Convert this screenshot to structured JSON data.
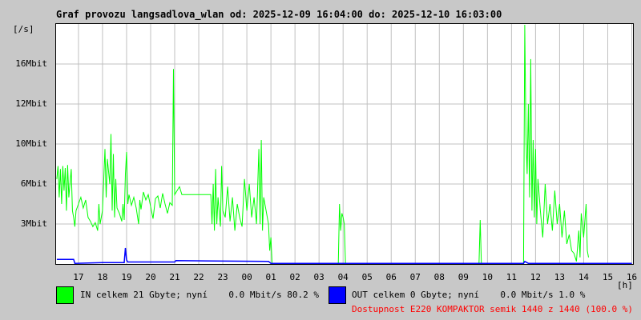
{
  "chart_data": {
    "type": "line",
    "title": "Graf provozu langsadlova_wlan od: 2025-12-09 16:04:00 do: 2025-12-10 16:03:00",
    "ylabel": "[/s]",
    "xlabel": "[h]",
    "y_ticks": [
      {
        "label": "3Mbit",
        "value": 3
      },
      {
        "label": "6Mbit",
        "value": 6
      },
      {
        "label": "10Mbit",
        "value": 10
      },
      {
        "label": "12Mbit",
        "value": 12
      },
      {
        "label": "16Mbit",
        "value": 16
      }
    ],
    "x_ticks": [
      {
        "label": "17",
        "hour": 17
      },
      {
        "label": "18",
        "hour": 18
      },
      {
        "label": "19",
        "hour": 19
      },
      {
        "label": "20",
        "hour": 20
      },
      {
        "label": "21",
        "hour": 21
      },
      {
        "label": "22",
        "hour": 22
      },
      {
        "label": "23",
        "hour": 23
      },
      {
        "label": "00",
        "hour": 24
      },
      {
        "label": "01",
        "hour": 25
      },
      {
        "label": "02",
        "hour": 26
      },
      {
        "label": "03",
        "hour": 27
      },
      {
        "label": "04",
        "hour": 28
      },
      {
        "label": "05",
        "hour": 29
      },
      {
        "label": "06",
        "hour": 30
      },
      {
        "label": "07",
        "hour": 31
      },
      {
        "label": "08",
        "hour": 32
      },
      {
        "label": "09",
        "hour": 33
      },
      {
        "label": "10",
        "hour": 34
      },
      {
        "label": "11",
        "hour": 35
      },
      {
        "label": "12",
        "hour": 36
      },
      {
        "label": "13",
        "hour": 37
      },
      {
        "label": "14",
        "hour": 38
      },
      {
        "label": "15",
        "hour": 39
      },
      {
        "label": "16",
        "hour": 40
      }
    ],
    "x_range_hours": [
      16.07,
      40.05
    ],
    "grid": true,
    "series": [
      {
        "name": "IN",
        "color": "#00ff00",
        "points": [
          [
            16.1,
            6.5
          ],
          [
            16.15,
            7.8
          ],
          [
            16.2,
            5
          ],
          [
            16.25,
            7.5
          ],
          [
            16.3,
            4.5
          ],
          [
            16.35,
            7.8
          ],
          [
            16.4,
            5.5
          ],
          [
            16.45,
            7.6
          ],
          [
            16.5,
            4
          ],
          [
            16.55,
            7.9
          ],
          [
            16.6,
            5
          ],
          [
            16.7,
            7.5
          ],
          [
            16.75,
            4
          ],
          [
            16.8,
            3.5
          ],
          [
            16.85,
            2.8
          ],
          [
            16.9,
            4
          ],
          [
            17.0,
            4.5
          ],
          [
            17.1,
            5
          ],
          [
            17.2,
            4.2
          ],
          [
            17.3,
            4.8
          ],
          [
            17.4,
            3.5
          ],
          [
            17.5,
            3.2
          ],
          [
            17.6,
            2.8
          ],
          [
            17.7,
            3.1
          ],
          [
            17.8,
            2.5
          ],
          [
            17.85,
            4.5
          ],
          [
            17.9,
            3
          ],
          [
            18.0,
            4
          ],
          [
            18.1,
            9.5
          ],
          [
            18.15,
            5
          ],
          [
            18.2,
            8.5
          ],
          [
            18.3,
            6
          ],
          [
            18.35,
            10.5
          ],
          [
            18.4,
            4
          ],
          [
            18.45,
            9
          ],
          [
            18.5,
            3.5
          ],
          [
            18.55,
            6.5
          ],
          [
            18.6,
            4.2
          ],
          [
            18.7,
            3.8
          ],
          [
            18.8,
            3.2
          ],
          [
            18.85,
            4.5
          ],
          [
            18.9,
            3.3
          ],
          [
            18.95,
            7
          ],
          [
            19.0,
            9.2
          ],
          [
            19.05,
            4.5
          ],
          [
            19.1,
            5.2
          ],
          [
            19.2,
            4.4
          ],
          [
            19.3,
            5.0
          ],
          [
            19.4,
            4.2
          ],
          [
            19.5,
            3.0
          ],
          [
            19.55,
            4.8
          ],
          [
            19.6,
            4.1
          ],
          [
            19.7,
            5.4
          ],
          [
            19.8,
            4.8
          ],
          [
            19.9,
            5.2
          ],
          [
            20.0,
            4.3
          ],
          [
            20.1,
            3.4
          ],
          [
            20.2,
            4.9
          ],
          [
            20.3,
            5.1
          ],
          [
            20.4,
            4.2
          ],
          [
            20.5,
            5.3
          ],
          [
            20.6,
            4.5
          ],
          [
            20.7,
            3.8
          ],
          [
            20.8,
            4.6
          ],
          [
            20.9,
            4.4
          ],
          [
            20.95,
            15.5
          ],
          [
            21.0,
            5.2
          ],
          [
            21.2,
            5.8
          ],
          [
            21.3,
            5.2
          ],
          [
            22.5,
            5.2
          ],
          [
            22.55,
            3.0
          ],
          [
            22.6,
            6
          ],
          [
            22.65,
            2.5
          ],
          [
            22.7,
            7.5
          ],
          [
            22.75,
            3
          ],
          [
            22.8,
            5
          ],
          [
            22.9,
            2.8
          ],
          [
            22.95,
            7.8
          ],
          [
            23.0,
            4
          ],
          [
            23.1,
            3.5
          ],
          [
            23.2,
            5.8
          ],
          [
            23.3,
            3.2
          ],
          [
            23.4,
            5
          ],
          [
            23.5,
            2.5
          ],
          [
            23.6,
            4.5
          ],
          [
            23.7,
            3.5
          ],
          [
            23.8,
            2.8
          ],
          [
            23.9,
            6.5
          ],
          [
            24.0,
            4
          ],
          [
            24.1,
            6
          ],
          [
            24.2,
            3.5
          ],
          [
            24.3,
            5
          ],
          [
            24.4,
            3
          ],
          [
            24.5,
            9.5
          ],
          [
            24.55,
            3
          ],
          [
            24.6,
            10.2
          ],
          [
            24.65,
            2.5
          ],
          [
            24.7,
            5
          ],
          [
            24.8,
            4
          ],
          [
            24.9,
            3
          ],
          [
            24.95,
            1
          ],
          [
            25.0,
            2
          ],
          [
            25.05,
            0
          ],
          [
            27.8,
            0
          ],
          [
            27.85,
            4.5
          ],
          [
            27.9,
            2.5
          ],
          [
            27.95,
            3.8
          ],
          [
            28.0,
            3.5
          ],
          [
            28.05,
            3
          ],
          [
            28.1,
            0
          ],
          [
            33.65,
            0
          ],
          [
            33.7,
            3.3
          ],
          [
            33.75,
            0
          ],
          [
            35.5,
            0
          ],
          [
            35.55,
            20
          ],
          [
            35.6,
            10.5
          ],
          [
            35.65,
            7
          ],
          [
            35.7,
            12
          ],
          [
            35.75,
            5
          ],
          [
            35.8,
            16.5
          ],
          [
            35.85,
            4
          ],
          [
            35.9,
            10.2
          ],
          [
            35.95,
            3.5
          ],
          [
            36.0,
            9.5
          ],
          [
            36.05,
            3
          ],
          [
            36.1,
            6.5
          ],
          [
            36.2,
            4
          ],
          [
            36.3,
            2
          ],
          [
            36.4,
            6
          ],
          [
            36.5,
            3
          ],
          [
            36.6,
            4.5
          ],
          [
            36.7,
            2.5
          ],
          [
            36.8,
            5.5
          ],
          [
            36.9,
            3
          ],
          [
            37.0,
            4.5
          ],
          [
            37.1,
            2
          ],
          [
            37.2,
            4
          ],
          [
            37.3,
            1.5
          ],
          [
            37.4,
            2.2
          ],
          [
            37.5,
            1.0
          ],
          [
            37.6,
            0.8
          ],
          [
            37.7,
            0.2
          ],
          [
            37.8,
            2.5
          ],
          [
            37.85,
            0.5
          ],
          [
            37.9,
            3.8
          ],
          [
            38.0,
            2.0
          ],
          [
            38.1,
            4.5
          ],
          [
            38.15,
            1
          ],
          [
            38.2,
            0.5
          ]
        ]
      },
      {
        "name": "OUT",
        "color": "#0000ff",
        "points": [
          [
            16.1,
            0.35
          ],
          [
            16.8,
            0.35
          ],
          [
            16.85,
            0.05
          ],
          [
            18.0,
            0.1
          ],
          [
            18.9,
            0.1
          ],
          [
            18.95,
            1.2
          ],
          [
            19.0,
            0.3
          ],
          [
            19.05,
            0.15
          ],
          [
            21.0,
            0.15
          ],
          [
            21.05,
            0.25
          ],
          [
            24.9,
            0.2
          ],
          [
            25.0,
            0.05
          ],
          [
            35.5,
            0.05
          ],
          [
            35.55,
            0.2
          ],
          [
            35.7,
            0.05
          ],
          [
            40.0,
            0.05
          ]
        ]
      }
    ]
  },
  "legend": {
    "in_text": "IN celkem 21 Gbyte; nyní    0.0 Mbit/s 80.2 %",
    "out_text": "OUT celkem 0 Gbyte; nyní    0.0 Mbit/s 1.0 %",
    "in_color": "#00ff00",
    "out_color": "#0000ff",
    "availability": "Dostupnost E220 KOMPAKTOR semik 1440 z 1440 (100.0 %)"
  }
}
